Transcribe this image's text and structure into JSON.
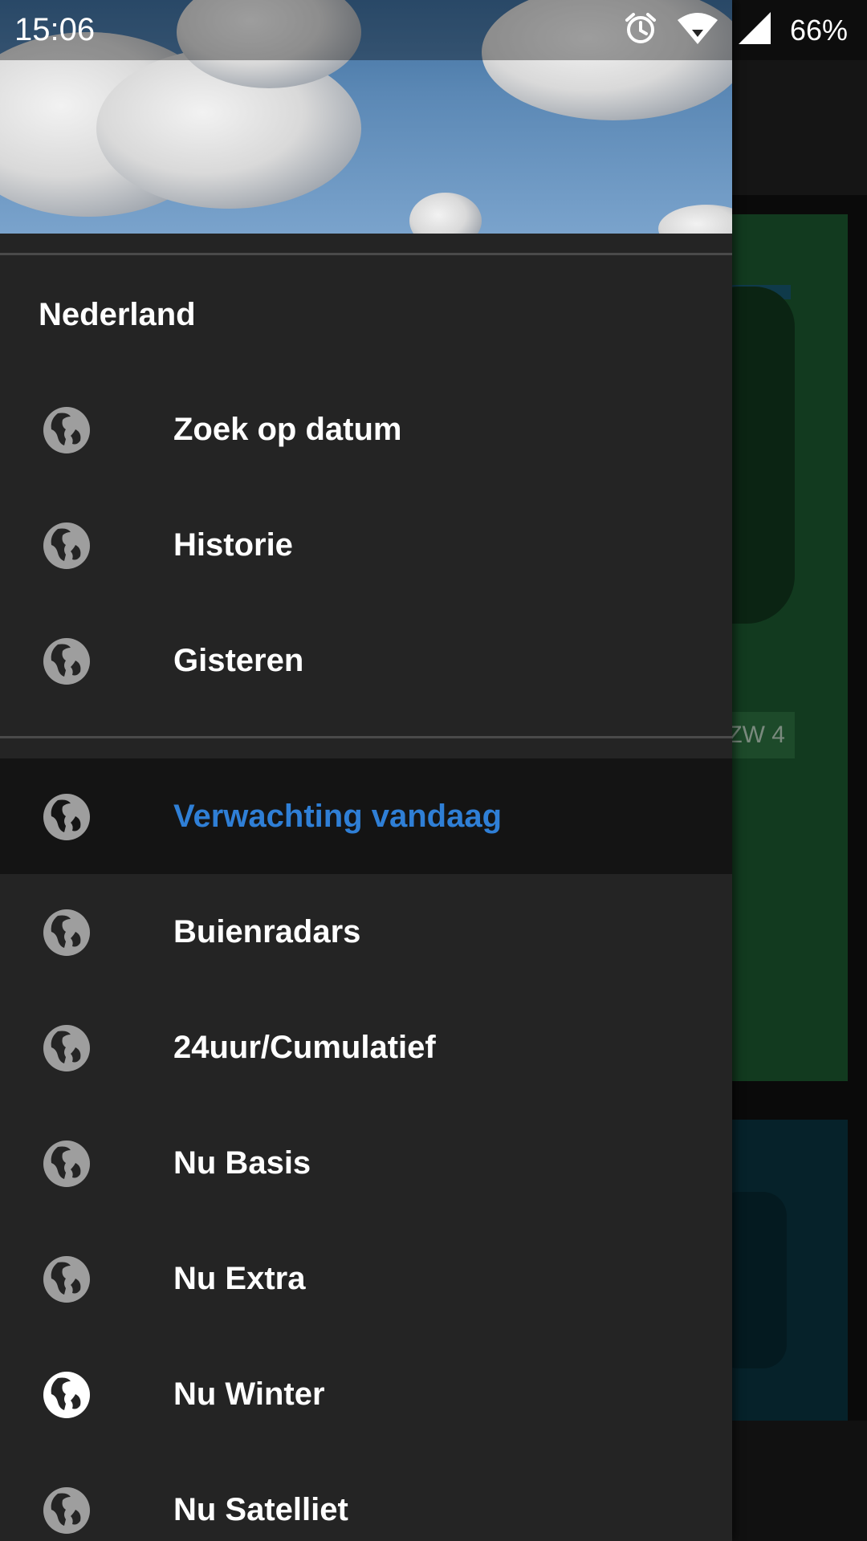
{
  "status_bar": {
    "time": "15:06",
    "battery": "66%",
    "icons": [
      "alarm-icon",
      "wifi-icon",
      "signal-icon"
    ]
  },
  "background_app": {
    "map_label": "ZW 4"
  },
  "drawer": {
    "section_title": "Nederland",
    "group1": [
      {
        "label": "Zoek op datum",
        "icon": "globe-icon"
      },
      {
        "label": "Historie",
        "icon": "globe-icon"
      },
      {
        "label": "Gisteren",
        "icon": "globe-icon"
      }
    ],
    "group2": [
      {
        "label": "Verwachting vandaag",
        "icon": "globe-icon",
        "active": true
      },
      {
        "label": "Buienradars",
        "icon": "globe-icon"
      },
      {
        "label": "24uur/Cumulatief",
        "icon": "globe-icon"
      },
      {
        "label": "Nu Basis",
        "icon": "globe-icon"
      },
      {
        "label": "Nu Extra",
        "icon": "globe-icon"
      },
      {
        "label": "Nu Winter",
        "icon": "globe-icon"
      },
      {
        "label": "Nu Satelliet",
        "icon": "globe-icon"
      }
    ]
  },
  "colors": {
    "active_label": "#2f7fd6",
    "drawer_bg": "#242424",
    "active_row_bg": "#141414",
    "icon_default": "#9e9e9e",
    "icon_bright": "#ffffff"
  }
}
